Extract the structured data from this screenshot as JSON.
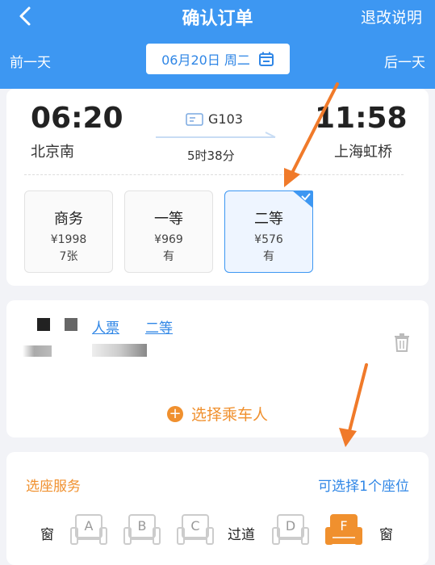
{
  "header": {
    "title": "确认订单",
    "refund_label": "退改说明",
    "prev_day": "前一天",
    "next_day": "后一天",
    "date": "06月20日 周二",
    "bg_color": "#3d97f2"
  },
  "train": {
    "depart_time": "06:20",
    "depart_station": "北京南",
    "train_no": "G103",
    "duration": "5时38分",
    "arrive_time": "11:58",
    "arrive_station": "上海虹桥"
  },
  "seat_classes": [
    {
      "name": "商务",
      "price": "¥1998",
      "availability": "7张",
      "selected": false
    },
    {
      "name": "一等",
      "price": "¥969",
      "availability": "有",
      "selected": false
    },
    {
      "name": "二等",
      "price": "¥576",
      "availability": "有",
      "selected": true
    }
  ],
  "passenger": {
    "ticket_type": "人票",
    "seat_class": "二等"
  },
  "add_passenger_label": "选择乘车人",
  "seat_service": {
    "title": "选座服务",
    "hint": "可选择1个座位",
    "window_label": "窗",
    "aisle_label": "过道",
    "seats": [
      {
        "letter": "A",
        "selected": false
      },
      {
        "letter": "B",
        "selected": false
      },
      {
        "letter": "C",
        "selected": false
      },
      {
        "letter": "D",
        "selected": false
      },
      {
        "letter": "F",
        "selected": true
      }
    ],
    "accent_color": "#f0902e"
  }
}
